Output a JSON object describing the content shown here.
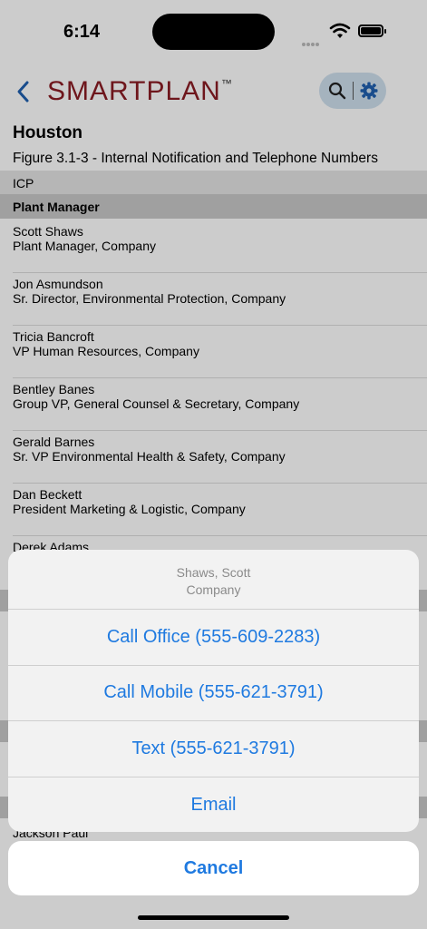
{
  "status": {
    "time": "6:14"
  },
  "nav": {
    "logo_smart": "SMART",
    "logo_plan": "PLAN",
    "logo_tm": "™"
  },
  "header": {
    "place": "Houston",
    "figure": "Figure 3.1-3 - Internal Notification and Telephone Numbers"
  },
  "sections": {
    "icp": "ICP",
    "plant_manager": "Plant Manager"
  },
  "contacts": [
    {
      "name": "Scott Shaws",
      "title": "Plant Manager, Company"
    },
    {
      "name": "Jon Asmundson",
      "title": "Sr. Director, Environmental Protection, Company"
    },
    {
      "name": "Tricia Bancroft",
      "title": "VP Human Resources, Company"
    },
    {
      "name": "Bentley Banes",
      "title": "Group VP, General Counsel & Secretary, Company"
    },
    {
      "name": "Gerald Barnes",
      "title": "Sr. VP Environmental Health & Safety, Company"
    },
    {
      "name": "Dan Beckett",
      "title": "President Marketing & Logistic, Company"
    }
  ],
  "partial": {
    "derek": "Derek Adams",
    "jackson": "Jackson Paul"
  },
  "sheet": {
    "name": "Shaws, Scott",
    "company": "Company",
    "call_office": "Call Office (555-609-2283)",
    "call_mobile": "Call Mobile (555-621-3791)",
    "text": "Text (555-621-3791)",
    "email": "Email",
    "cancel": "Cancel"
  },
  "colors": {
    "accent": "#1f7ae0",
    "brand": "#8a1c24"
  }
}
